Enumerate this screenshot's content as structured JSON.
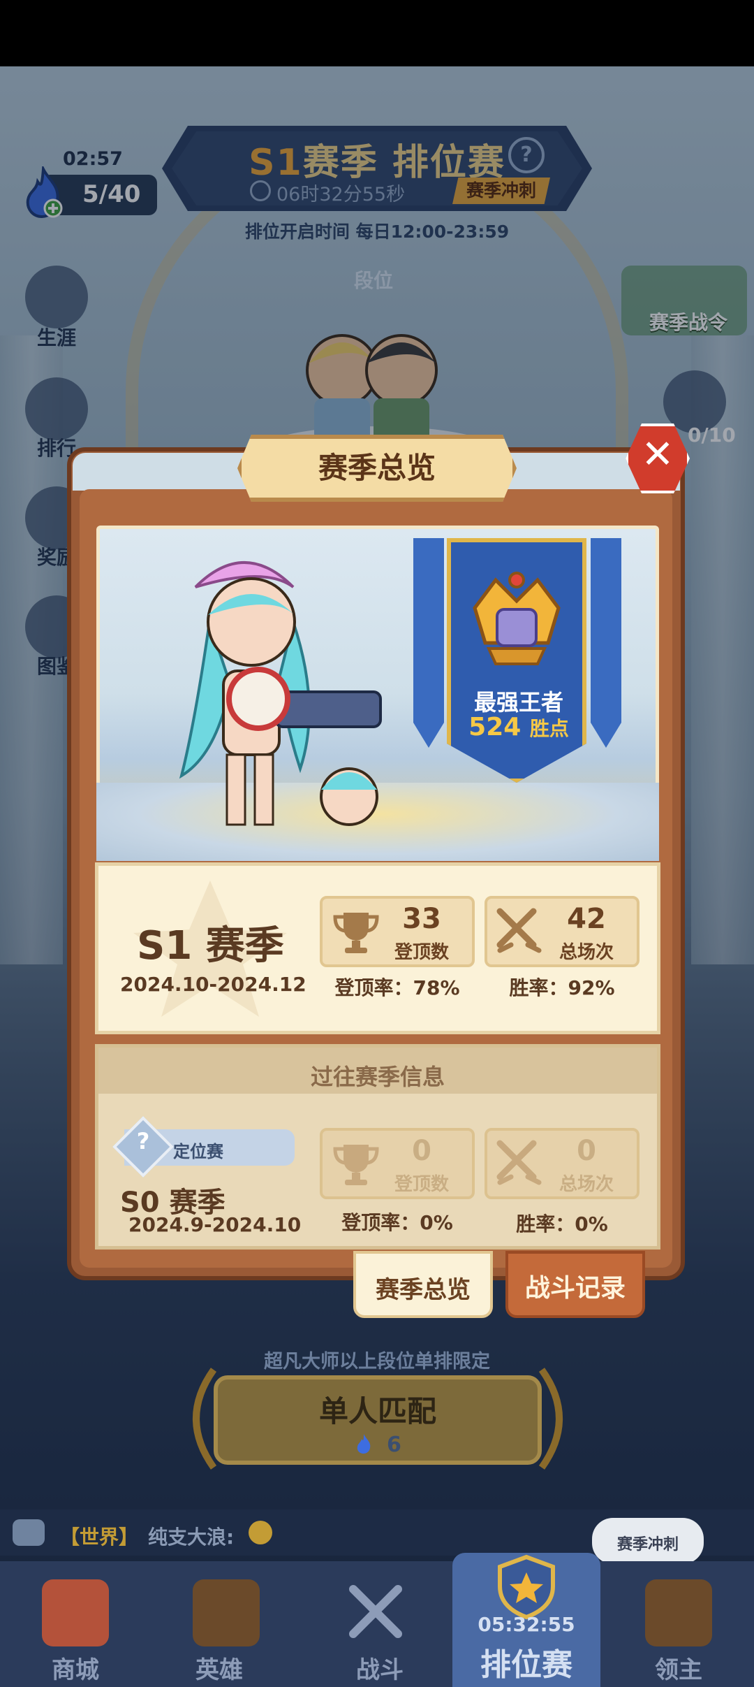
{
  "header": {
    "energy_timer": "02:57",
    "energy": "5/40",
    "season_prefix": "S1",
    "season_title": "赛季 排位赛",
    "countdown": "06时32分55秒",
    "sprint_tag": "赛季冲刺",
    "open_time": "排位开启时间 每日12:00-23:59",
    "rank_label": "段位",
    "season_pass": "赛季战令",
    "gem_count": "0/10"
  },
  "side_menu": [
    {
      "label": "生涯",
      "icon": "career-icon"
    },
    {
      "label": "排行",
      "icon": "ranking-icon"
    },
    {
      "label": "奖励",
      "icon": "reward-icon"
    },
    {
      "label": "图鉴",
      "icon": "codex-icon"
    }
  ],
  "modal": {
    "title": "赛季总览",
    "rank_name": "最强王者",
    "rank_points_value": "524",
    "rank_points_unit": "胜点",
    "current": {
      "season": "S1",
      "season_suffix": "赛季",
      "dates": "2024.10-2024.12",
      "top_count": "33",
      "top_label": "登顶数",
      "games_count": "42",
      "games_label": "总场次",
      "top_rate": "登顶率：78%",
      "win_rate": "胜率：92%"
    },
    "past": {
      "header": "过往赛季信息",
      "placement": "定位赛",
      "placement_icon_glyph": "?",
      "season": "S0",
      "season_suffix": "赛季",
      "dates": "2024.9-2024.10",
      "top_count": "0",
      "top_label": "登顶数",
      "games_count": "0",
      "games_label": "总场次",
      "top_rate": "登顶率：0%",
      "win_rate": "胜率：0%"
    },
    "tabs": {
      "overview": "赛季总览",
      "record": "战斗记录"
    }
  },
  "match": {
    "limit_text": "超凡大师以上段位单排限定",
    "button_label": "单人匹配",
    "cost": "6"
  },
  "chat": {
    "channel": "【世界】",
    "message": "纯支大浪:"
  },
  "sprint_bubble": "赛季冲刺",
  "nav": [
    {
      "label": "商城",
      "icon": "shop-icon"
    },
    {
      "label": "英雄",
      "icon": "hero-card-icon"
    },
    {
      "label": "战斗",
      "icon": "battle-swords-icon"
    },
    {
      "label": "排位赛",
      "icon": "ranked-shield-icon",
      "timer": "05:32:55",
      "active": true
    },
    {
      "label": "领主",
      "icon": "lord-banner-icon"
    }
  ],
  "colors": {
    "accent_gold": "#f0a838",
    "modal_wood": "#9a5a36",
    "close_red": "#d13c2c",
    "nav_active": "#4a6aa4"
  }
}
